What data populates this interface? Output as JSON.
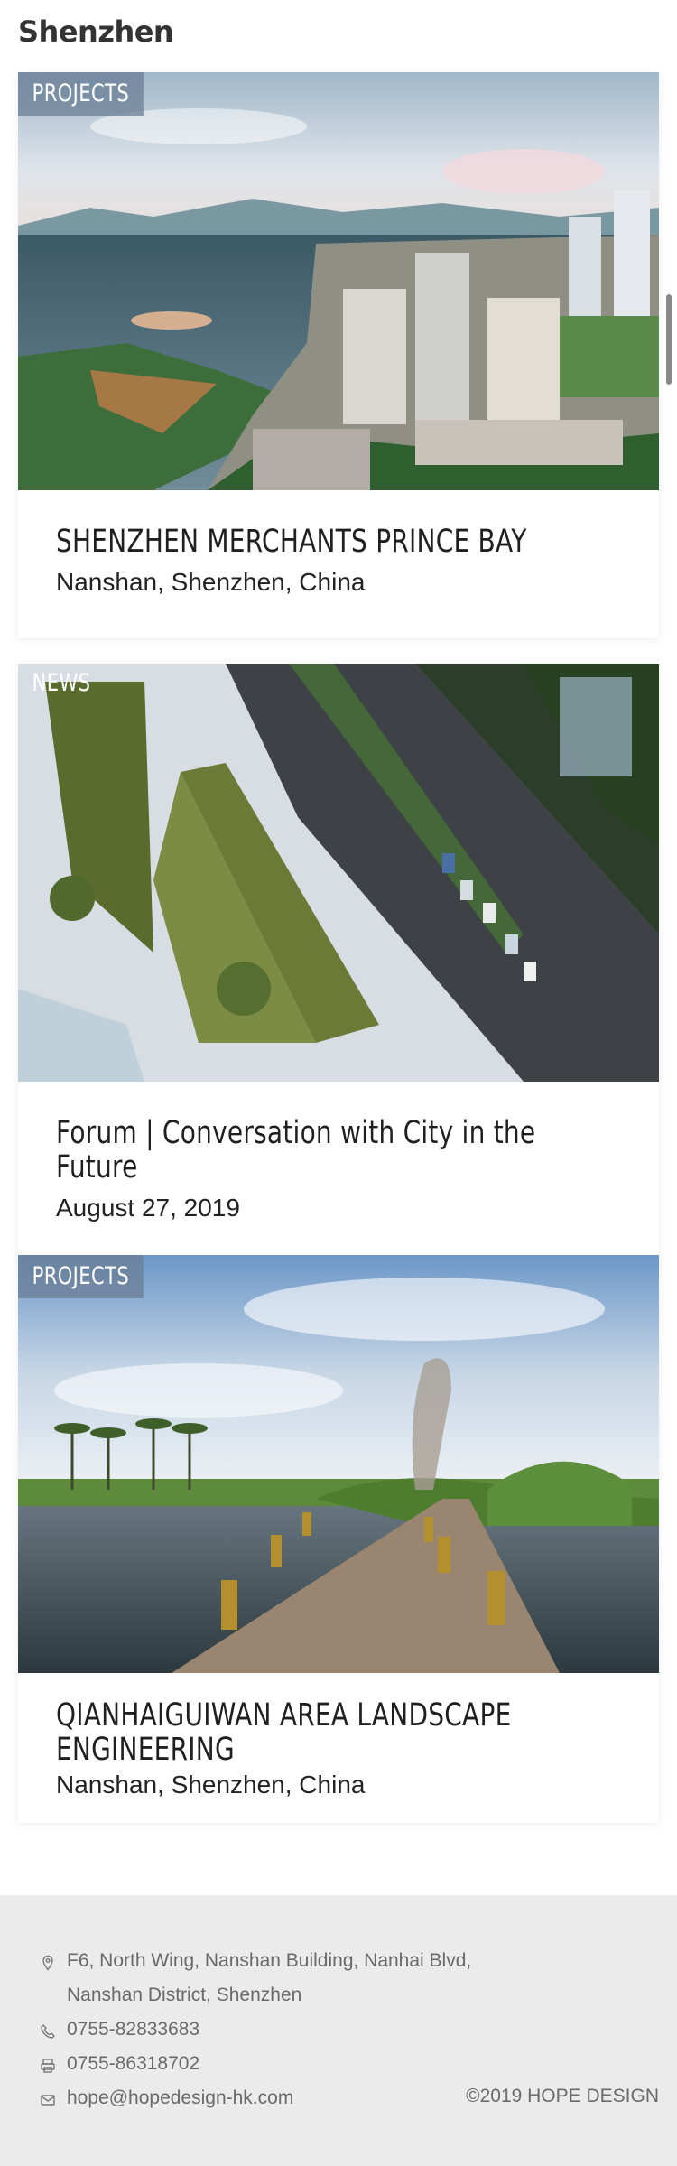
{
  "page": {
    "title": "Shenzhen"
  },
  "cards": [
    {
      "tag": "PROJECTS",
      "title": "SHENZHEN MERCHANTS PRINCE BAY",
      "subtitle": "Nanshan, Shenzhen, China"
    },
    {
      "tag": "NEWS",
      "title": "Forum | Conversation with City in the Future",
      "subtitle": "August  27,  2019"
    },
    {
      "tag": "PROJECTS",
      "title": "QIANHAIGUIWAN AREA LANDSCAPE ENGINEERING",
      "subtitle": "Nanshan, Shenzhen, China"
    }
  ],
  "footer": {
    "address_line1": "F6, North Wing, Nanshan Building, Nanhai Blvd,",
    "address_line2": "Nanshan District, Shenzhen",
    "phone": "0755-82833683",
    "fax": "0755-86318702",
    "email": "hope@hopedesign-hk.com",
    "copyright": "©2019 HOPE DESIGN",
    "icons": [
      "location-pin-icon",
      "phone-icon",
      "fax-icon",
      "mail-icon"
    ]
  },
  "colors": {
    "tag_bg": "#697d96",
    "footer_bg": "#ebebeb",
    "footer_text": "#6a6a6a"
  }
}
